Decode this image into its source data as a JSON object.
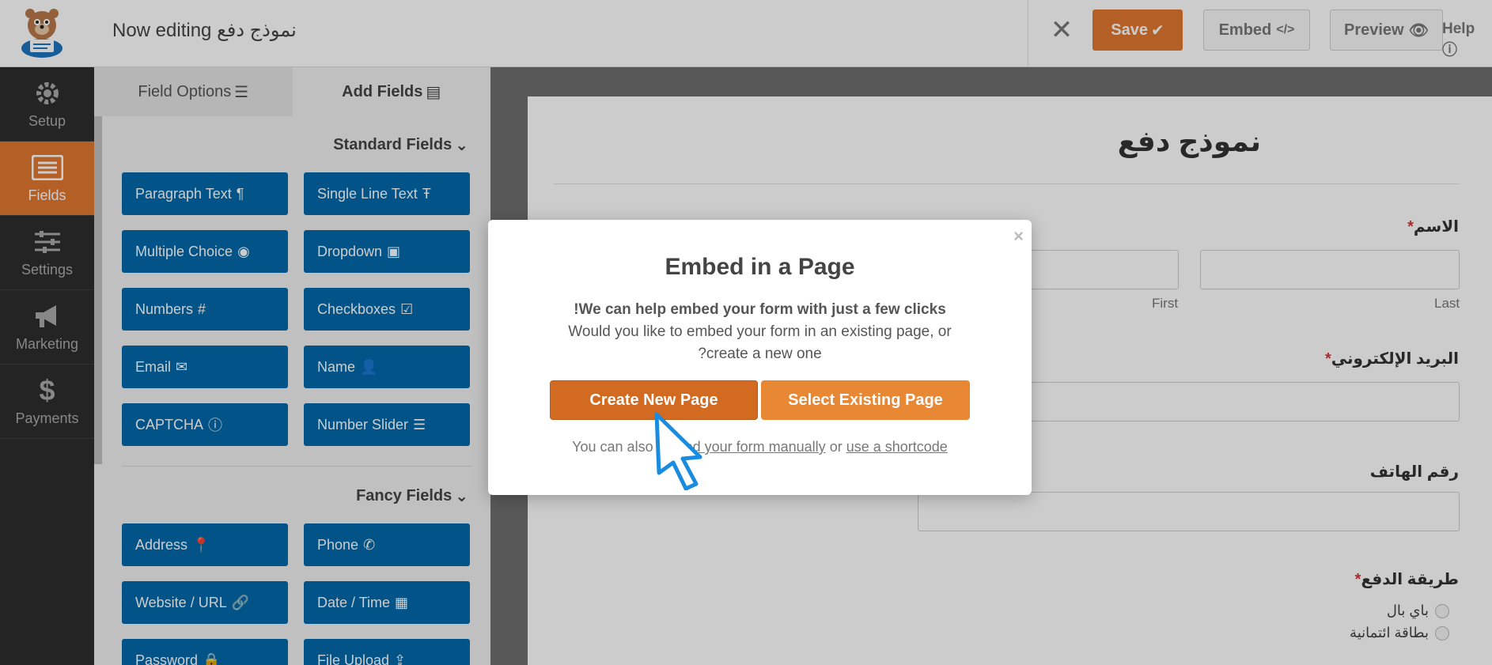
{
  "header": {
    "form_title": "Now editing نموذج دفع",
    "save_label": "Save",
    "embed_label": "Embed",
    "preview_label": "Preview",
    "help_label": "Help"
  },
  "nav": {
    "items": [
      {
        "label": "Setup",
        "icon": "gear-icon"
      },
      {
        "label": "Fields",
        "icon": "fields-icon",
        "active": true
      },
      {
        "label": "Settings",
        "icon": "sliders-icon"
      },
      {
        "label": "Marketing",
        "icon": "megaphone-icon"
      },
      {
        "label": "Payments",
        "icon": "dollar-icon"
      }
    ]
  },
  "panel": {
    "tab_field_options": "Field Options",
    "tab_add_fields": "Add Fields",
    "standard_heading": "Standard Fields",
    "fancy_heading": "Fancy Fields",
    "standard_fields": [
      "Paragraph Text",
      "Single Line Text",
      "Multiple Choice",
      "Dropdown",
      "Numbers",
      "Checkboxes",
      "Email",
      "Name",
      "CAPTCHA",
      "Number Slider"
    ],
    "fancy_fields": [
      "Address",
      "Phone",
      "Website / URL",
      "Date / Time",
      "Password",
      "File Upload"
    ]
  },
  "preview": {
    "title": "نموذج دفع",
    "name_label": "الاسم",
    "first_label": "First",
    "last_label": "Last",
    "email_label": "البريد الإلكتروني",
    "phone_label": "رقم الهاتف",
    "payment_label": "طريقة الدفع",
    "payment_options": [
      "باي بال",
      "بطاقة ائتمانية"
    ],
    "required_mark": "*"
  },
  "modal": {
    "close": "×",
    "title": "Embed in a Page",
    "line1": "!We can help embed your form with just a few clicks",
    "line2": "Would you like to embed your form in an existing page, or",
    "line3": "?create a new one",
    "create_label": "Create New Page",
    "select_label": "Select Existing Page",
    "foot_prefix": "You can also",
    "foot_link1": "embed your form manually",
    "foot_mid": "or",
    "foot_link2": "use a shortcode"
  },
  "colors": {
    "accent": "#e27730",
    "field_button": "#036aab",
    "nav_bg": "#2d2d2d"
  }
}
